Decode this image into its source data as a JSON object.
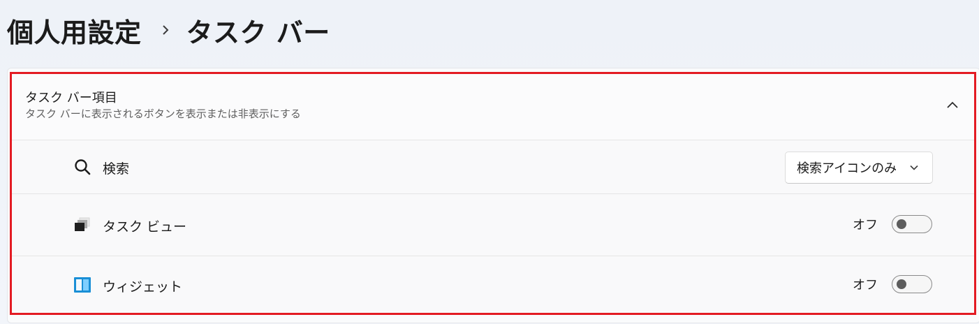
{
  "header": {
    "parent": "個人用設定",
    "current": "タスク バー"
  },
  "section": {
    "title": "タスク バー項目",
    "subtitle": "タスク バーに表示されるボタンを表示または非表示にする"
  },
  "items": {
    "search": {
      "label": "検索",
      "icon": "search-icon",
      "dropdown_value": "検索アイコンのみ"
    },
    "taskview": {
      "label": "タスク ビュー",
      "icon": "task-view-icon",
      "state_label": "オフ",
      "enabled": false
    },
    "widgets": {
      "label": "ウィジェット",
      "icon": "widgets-icon",
      "state_label": "オフ",
      "enabled": false
    }
  },
  "colors": {
    "highlight": "#e31b23",
    "widgets_icon": "#1a8fd6",
    "toggle_knob": "#5d5d5d"
  }
}
